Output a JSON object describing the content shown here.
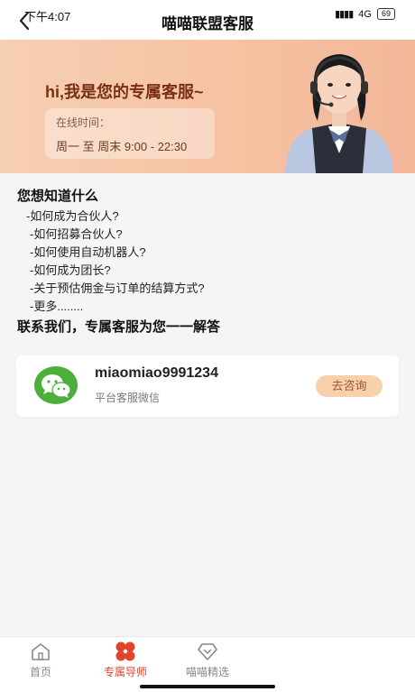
{
  "status_bar": {
    "time": "下午4:07",
    "network": "4G",
    "battery": "69"
  },
  "header": {
    "title": "喵喵联盟客服"
  },
  "banner": {
    "greeting": "hi,我是您的专属客服~",
    "hours_label": "在线时间：",
    "hours_value": "周一 至 周末 9:00 - 22:30"
  },
  "faq": {
    "title": "您想知道什么",
    "items": [
      "-如何成为合伙人?",
      "-如何招募合伙人?",
      "-如何使用自动机器人?",
      "-如何成为团长?",
      "-关于预估佣金与订单的结算方式?",
      "-更多........"
    ],
    "footer": "联系我们，专属客服为您一一解答"
  },
  "contact": {
    "wechat_id": "miaomiao9991234",
    "subtitle": "平台客服微信",
    "button": "去咨询"
  },
  "tabs": [
    {
      "label": "首页",
      "icon": "home-icon",
      "active": false
    },
    {
      "label": "专属导师",
      "icon": "mentor-icon",
      "active": true
    },
    {
      "label": "喵喵精选",
      "icon": "diamond-icon",
      "active": false
    }
  ],
  "colors": {
    "accent": "#e0452a",
    "banner": "#f5c1a1",
    "button": "#f8d1ac"
  }
}
